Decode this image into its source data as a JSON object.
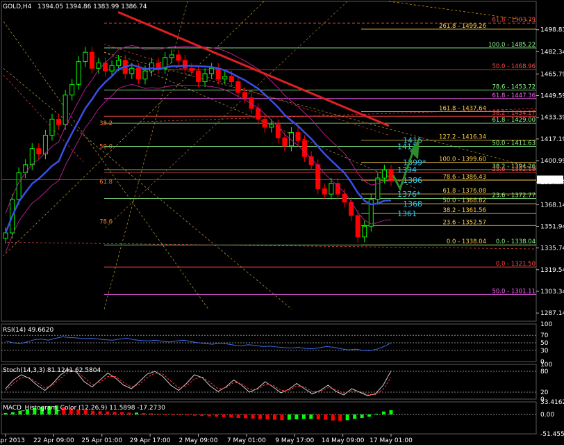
{
  "colors": {
    "background": "#000000",
    "bull": "#00ff00",
    "bear": "#ff0000",
    "ma_blue": "#3a4fe6",
    "envelope": "#b01e8c",
    "fib_red": "#ff4a4a",
    "fib_yellow": "#ffd24a",
    "fib_green": "#8dfc8d",
    "fib_pink": "#ff66ff",
    "annotation": "#29c7f2",
    "arrow": "#2e8b2e"
  },
  "chart_data": [
    {
      "type": "candlestick",
      "title": "GOLD,H4",
      "ohlc_label": "1394.05 1394.86 1383.99 1386.74",
      "current_price": 1386.74,
      "ylim": [
        1281,
        1520
      ],
      "price_ticks": [
        "1498.83",
        "1482.34",
        "1465.79",
        "1449.59",
        "1433.39",
        "1417.19",
        "1400.99",
        "1384.79",
        "1368.14",
        "1351.94",
        "1335.74",
        "1319.54",
        "1303.34",
        "1287.14"
      ],
      "x_ticks": [
        "17 Apr 2013",
        "22 Apr 09:00",
        "25 Apr 01:00",
        "29 Apr 17:00",
        "2 May 09:00",
        "7 May 01:00",
        "9 May 17:00",
        "14 May 09:00",
        "17 May 01:00"
      ],
      "close_path": [
        1347,
        1372,
        1392,
        1398,
        1410,
        1406,
        1420,
        1432,
        1428,
        1450,
        1458,
        1475,
        1482,
        1470,
        1474,
        1468,
        1472,
        1476,
        1466,
        1470,
        1462,
        1468,
        1474,
        1470,
        1478,
        1480,
        1476,
        1470,
        1468,
        1460,
        1466,
        1470,
        1462,
        1464,
        1460,
        1452,
        1448,
        1440,
        1432,
        1426,
        1428,
        1418,
        1412,
        1422,
        1416,
        1404,
        1398,
        1380,
        1376,
        1384,
        1376,
        1370,
        1360,
        1344,
        1352,
        1372,
        1388,
        1394,
        1386
      ],
      "fib_levels": [
        {
          "label": "61.8 - 1503.79",
          "price": 1503.79,
          "color": "fib_red"
        },
        {
          "label": "261.8 - 1499.26",
          "price": 1499.26,
          "color": "fib_yellow"
        },
        {
          "label": "100.0 - 1485.22",
          "price": 1485.22,
          "color": "fib_green"
        },
        {
          "label": "50.0 - 1468.96",
          "price": 1468.96,
          "color": "fib_red"
        },
        {
          "label": "78.6 - 1453.72",
          "price": 1453.72,
          "color": "fib_green"
        },
        {
          "label": "61.8 - 1447.36",
          "price": 1447.36,
          "color": "fib_pink"
        },
        {
          "label": "161.8 - 1437.64",
          "price": 1437.64,
          "color": "fib_yellow"
        },
        {
          "label": "38.2 - 1434.17",
          "price": 1434.17,
          "color": "fib_red"
        },
        {
          "label": "61.8 - 1429.00",
          "price": 1429.0,
          "color": "fib_green"
        },
        {
          "label": "127.2 - 1416.34",
          "price": 1416.34,
          "color": "fib_yellow"
        },
        {
          "label": "50.0 - 1411.63",
          "price": 1411.63,
          "color": "fib_green"
        },
        {
          "label": "100.0 - 1399.60",
          "price": 1399.6,
          "color": "fib_yellow"
        },
        {
          "label": "38.2 - 1394.26",
          "price": 1394.26,
          "color": "fib_green"
        },
        {
          "label": "23.6 - 1392.18",
          "price": 1392.18,
          "color": "fib_red"
        },
        {
          "label": "78.6 - 1386.43",
          "price": 1386.43,
          "color": "fib_yellow"
        },
        {
          "label": "61.8 - 1376.08",
          "price": 1376.08,
          "color": "fib_yellow"
        },
        {
          "label": "23.6 - 1372.77",
          "price": 1372.77,
          "color": "fib_green"
        },
        {
          "label": "50.0 - 1368.82",
          "price": 1368.82,
          "color": "fib_yellow"
        },
        {
          "label": "38.2 - 1361.56",
          "price": 1361.56,
          "color": "fib_yellow"
        },
        {
          "label": "23.6 - 1352.57",
          "price": 1352.57,
          "color": "fib_yellow"
        },
        {
          "label": "0.0 - 1338.04",
          "price": 1338.04,
          "color": "fib_yellow"
        },
        {
          "label": "0.0 - 1338.04",
          "price": 1338.04,
          "color": "fib_green"
        },
        {
          "label": "0.0 - 1321.50",
          "price": 1321.5,
          "color": "fib_red"
        },
        {
          "label": "50.0 - 1301.11",
          "price": 1301.11,
          "color": "fib_pink"
        }
      ],
      "left_fib_labels": [
        {
          "label": "38.2",
          "price": 1429.0
        },
        {
          "label": "50.0",
          "price": 1411.6
        },
        {
          "label": "61.8",
          "price": 1385.4
        },
        {
          "label": "78.6",
          "price": 1355.5
        }
      ],
      "annotations": [
        {
          "label": "1416",
          "price": 1416.3
        },
        {
          "label": "1411",
          "price": 1411.6
        },
        {
          "label": "1399*",
          "price": 1399.6
        },
        {
          "label": "1394",
          "price": 1394.3
        },
        {
          "label": "1386",
          "price": 1386.4
        },
        {
          "label": "1376*",
          "price": 1376.1
        },
        {
          "label": "1368",
          "price": 1368.8
        },
        {
          "label": "1361",
          "price": 1361.6
        }
      ]
    },
    {
      "type": "line",
      "title": "RSI(14) 49.6620",
      "ylim": [
        0,
        100
      ],
      "levels": [
        70,
        50,
        30
      ],
      "ticks": [
        "100",
        "70",
        "50",
        "30",
        "0"
      ],
      "values": [
        55,
        50,
        48,
        52,
        58,
        60,
        57,
        62,
        66,
        64,
        63,
        61,
        62,
        60,
        58,
        57,
        60,
        62,
        58,
        56,
        55,
        57,
        54,
        52,
        55,
        57,
        53,
        50,
        48,
        46,
        49,
        47,
        44,
        42,
        45,
        43,
        40,
        41,
        39,
        37,
        36,
        38,
        35,
        34,
        37,
        40,
        38,
        34,
        31,
        33,
        30,
        29,
        33,
        40,
        49.66
      ]
    },
    {
      "type": "line",
      "title": "Stoch(14,3,3) 81.1241 62.5804",
      "ylim": [
        0,
        100
      ],
      "levels": [
        80,
        20
      ],
      "ticks": [
        "100",
        "80",
        "20",
        "0"
      ],
      "series": [
        {
          "values": [
            30,
            55,
            70,
            60,
            40,
            25,
            45,
            70,
            85,
            78,
            50,
            35,
            55,
            75,
            60,
            40,
            30,
            50,
            72,
            80,
            65,
            40,
            25,
            45,
            70,
            62,
            38,
            22,
            35,
            55,
            40,
            20,
            30,
            50,
            35,
            18,
            28,
            45,
            30,
            15,
            25,
            40,
            22,
            12,
            30,
            20,
            10,
            15,
            40,
            81.12
          ]
        },
        {
          "values": [
            25,
            45,
            62,
            62,
            48,
            32,
            40,
            60,
            78,
            80,
            62,
            42,
            48,
            65,
            65,
            48,
            35,
            42,
            62,
            75,
            72,
            52,
            32,
            38,
            58,
            64,
            48,
            30,
            32,
            48,
            45,
            28,
            28,
            42,
            40,
            25,
            25,
            38,
            35,
            22,
            22,
            33,
            28,
            17,
            24,
            22,
            14,
            13,
            28,
            62.58
          ]
        }
      ]
    },
    {
      "type": "bar",
      "title": "MACD_Histogram_Color (12,26,9) 11.5898 -17.2730",
      "ylim": [
        -51.4554,
        33.4162
      ],
      "ticks": [
        "33.4162",
        "0.00",
        "-51.4554"
      ],
      "values": [
        4,
        6,
        10,
        14,
        18,
        20,
        22,
        24,
        20,
        16,
        14,
        12,
        10,
        9,
        8,
        7,
        6,
        5,
        5,
        4,
        3,
        2,
        1,
        0,
        -1,
        -2,
        -3,
        -4,
        -5,
        -6,
        -7,
        -8,
        -9,
        -10,
        -11,
        -12,
        -13,
        -14,
        -15,
        -14,
        -13,
        -12,
        -12,
        -13,
        -14,
        -16,
        -17,
        -15,
        -12,
        -9,
        -6,
        2,
        8,
        11.59
      ]
    }
  ]
}
